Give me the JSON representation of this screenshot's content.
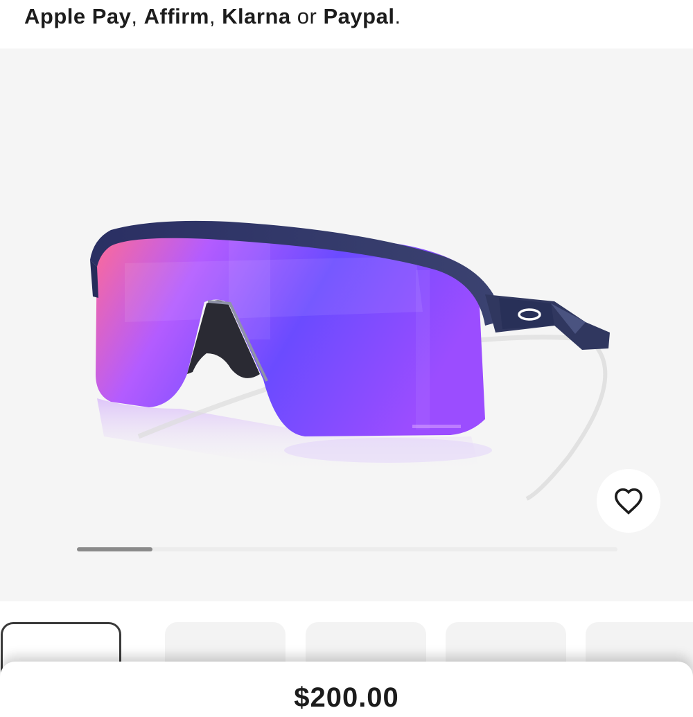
{
  "payment": {
    "methods": [
      "Apple Pay",
      "Affirm",
      "Klarna",
      "Paypal"
    ],
    "separator": ",",
    "conjunction": "or",
    "end": "."
  },
  "gallery": {
    "image_index_fraction": 0.14,
    "favorite_icon": "heart-icon"
  },
  "thumbnails": {
    "count": 5,
    "selected_index": 0
  },
  "price": {
    "amount": "$200.00"
  },
  "colors": {
    "lens_pink": "#ff5fa8",
    "lens_violet": "#9a4dff",
    "lens_blue": "#5b3fff",
    "frame_navy": "#262c5a",
    "background": "#f5f5f5"
  }
}
